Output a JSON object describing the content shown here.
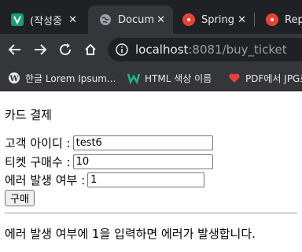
{
  "browser": {
    "tabs": [
      {
        "title": "(작성중",
        "icon": "v-logo-icon",
        "color": "#1a9c77"
      },
      {
        "title": "Docum",
        "icon": "globe-icon",
        "color": "#9aa0a6"
      },
      {
        "title": "Spring",
        "icon": "rocket-icon",
        "color": "#ea4335"
      },
      {
        "title": "Repo",
        "icon": "rocket-icon",
        "color": "#ea4335"
      }
    ],
    "address": {
      "host": "localhost",
      "rest": ":8081/buy_ticket"
    },
    "bookmarks": [
      {
        "label": "한글 Lorem Ipsum...",
        "icon": "wordpress-icon"
      },
      {
        "label": "HTML 색상 이름",
        "icon": "w-logo-icon"
      },
      {
        "label": "PDF에서 JPG로",
        "icon": "heart-icon"
      }
    ]
  },
  "page": {
    "heading": "카드 결제",
    "fields": [
      {
        "label": "고객 아이디 :",
        "value": "test6"
      },
      {
        "label": "티켓 구매수 :",
        "value": "10"
      },
      {
        "label": "에러 발생 여부 :",
        "value": "1"
      }
    ],
    "submit_label": "구매",
    "note": "에러 발생 여부에 1을 입력하면 에러가 발생합니다."
  }
}
